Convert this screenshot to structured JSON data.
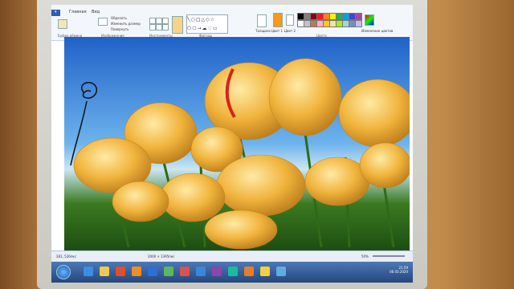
{
  "app": {
    "tabs": [
      "Главная",
      "Вид"
    ],
    "groups": [
      "Буфер обмена",
      "Изображение",
      "Инструменты",
      "Фигуры",
      "Цвета"
    ],
    "image_items": [
      "Обрезать",
      "Изменить размер",
      "Повернуть"
    ],
    "ribbon_right": [
      "Толщина",
      "Цвет 1",
      "Цвет 2",
      "Изменение цветов"
    ]
  },
  "colors": [
    "#000000",
    "#7f7f7f",
    "#880015",
    "#ed1c24",
    "#ff7f27",
    "#fff200",
    "#22b14c",
    "#00a2e8",
    "#3f48cc",
    "#a349a4",
    "#ffffff",
    "#c3c3c3",
    "#b97a57",
    "#ffaec9",
    "#ffc90e",
    "#efe4b0",
    "#b5e61d",
    "#99d9ea",
    "#7092be",
    "#c8bfe7"
  ],
  "status": {
    "cursor": "281, 526пкс",
    "size": "2000 × 1395пкс",
    "zoom": "50%"
  },
  "taskbar": {
    "time": "21:59",
    "date": "06.03.2020"
  }
}
